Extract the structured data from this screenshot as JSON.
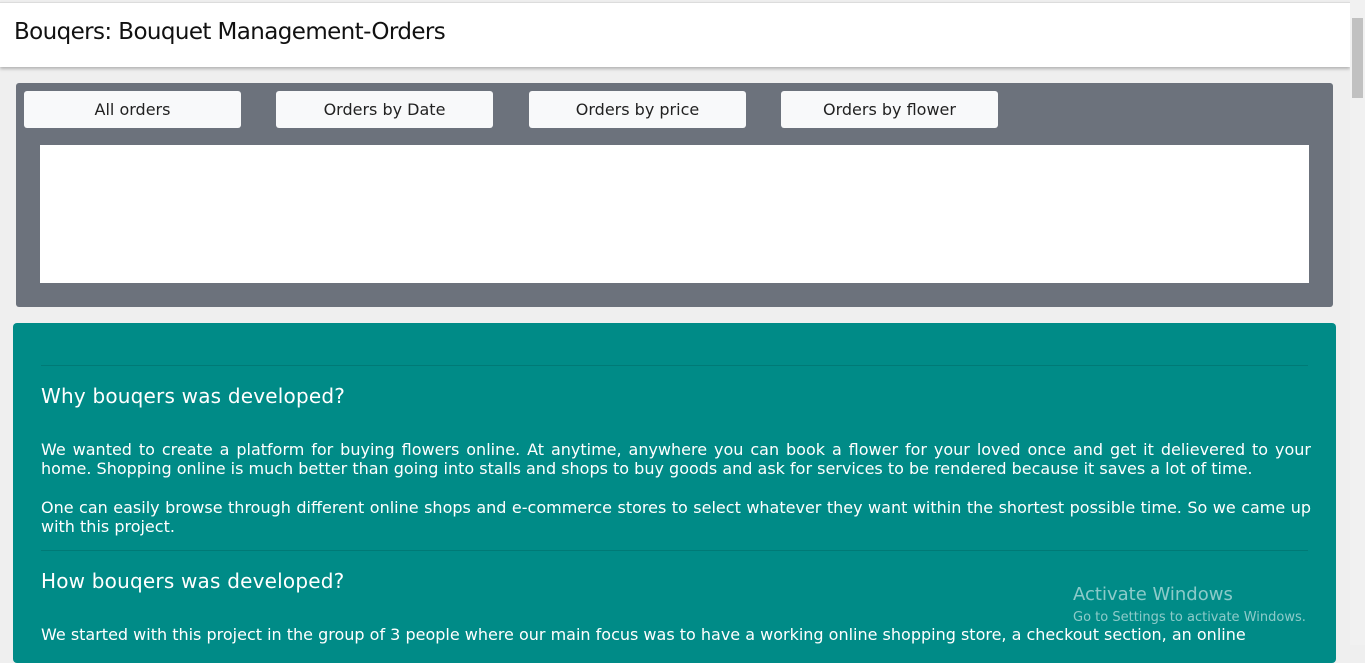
{
  "header": {
    "title": "Bouqers: Bouquet Management-Orders"
  },
  "orders_panel": {
    "tabs": [
      {
        "label": "All orders"
      },
      {
        "label": "Orders by Date"
      },
      {
        "label": "Orders by price"
      },
      {
        "label": "Orders by flower"
      }
    ]
  },
  "about": {
    "why_heading": "Why bouqers was developed?",
    "why_p1": "We wanted to create a platform for buying flowers online. At anytime, anywhere you can book a flower for your loved once and get it delievered to your home. Shopping online is much better than going into stalls and shops to buy goods and ask for services to be rendered because it saves a lot of time.",
    "why_p2": "One can easily browse through different online shops and e-commerce stores to select whatever they want within the shortest possible time. So we came up with this project.",
    "how_heading": "How bouqers was developed?",
    "how_p1": "We started with this project in the group of 3 people where our main focus was to have a working online shopping store, a checkout section, an online"
  },
  "watermark": {
    "title": "Activate Windows",
    "subtitle": "Go to Settings to activate Windows."
  },
  "colors": {
    "panel": "#6c727c",
    "about_bg": "#008b87",
    "button_bg": "#f8f9fa"
  }
}
